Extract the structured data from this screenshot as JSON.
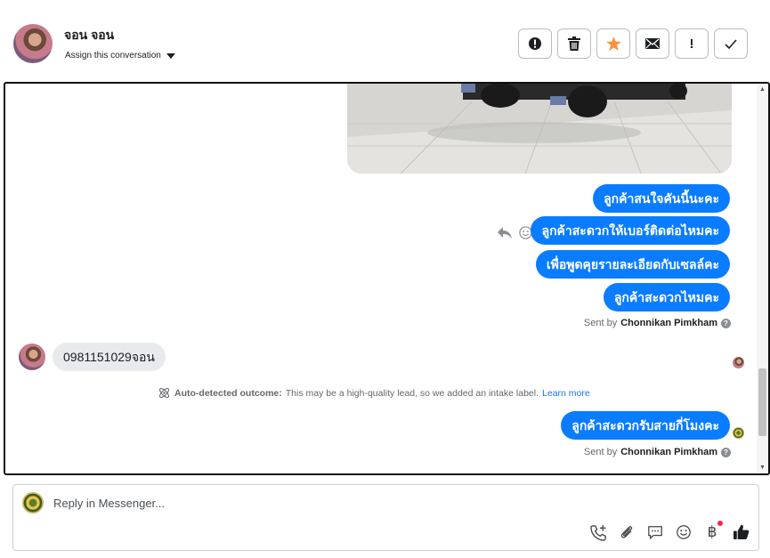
{
  "header": {
    "contact_name": "จอน จอน",
    "assign_label": "Assign this conversation",
    "actions": [
      {
        "name": "mark-spam-button",
        "icon": "alert-circle-icon"
      },
      {
        "name": "delete-button",
        "icon": "trash-icon"
      },
      {
        "name": "star-button",
        "icon": "star-icon"
      },
      {
        "name": "mark-unread-button",
        "icon": "envelope-icon"
      },
      {
        "name": "follow-up-button",
        "icon": "exclamation-icon"
      },
      {
        "name": "mark-done-button",
        "icon": "check-icon"
      }
    ],
    "star_color": "#f7923a"
  },
  "thread": {
    "outgoing_group_1": [
      "ลูกค้าสนใจคันนี้นะคะ",
      "ลูกค้าสะดวกให้เบอร์ติดต่อไหมคะ",
      "เพื่อพูดคุยรายละเอียดกับเซลล์คะ",
      "ลูกค้าสะดวกไหมคะ"
    ],
    "sent_by_prefix": "Sent by",
    "sent_by_name": "Chonnikan Pimkham",
    "incoming_message": "0981151029จอน",
    "auto_outcome_label": "Auto-detected outcome:",
    "auto_outcome_text": "This may be a high-quality lead, so we added an intake label.",
    "learn_more": "Learn more",
    "outgoing_group_2": [
      "ลูกค้าสะดวกรับสายกี่โมงคะ"
    ],
    "bubble_color": "#0a7cff"
  },
  "reply": {
    "placeholder": "Reply in Messenger..."
  }
}
